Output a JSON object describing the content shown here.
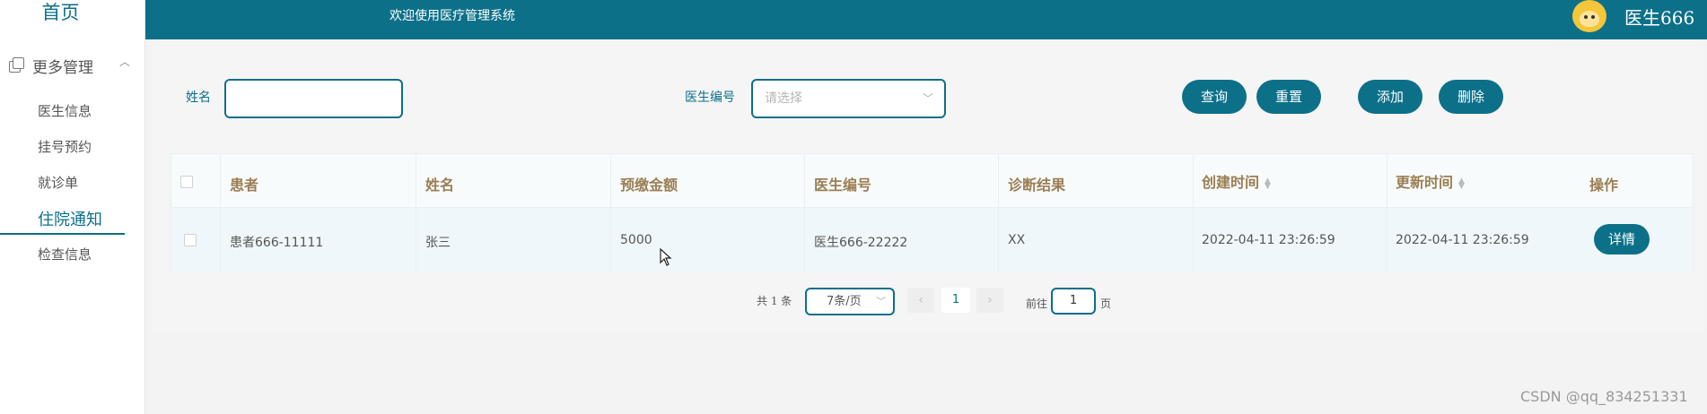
{
  "sidebar": {
    "home": "首页",
    "group_label": "更多管理",
    "items": [
      {
        "label": "医生信息"
      },
      {
        "label": "挂号预约"
      },
      {
        "label": "就诊单"
      },
      {
        "label": "住院通知"
      },
      {
        "label": "检查信息"
      }
    ],
    "active_index": 3
  },
  "header": {
    "welcome": "欢迎使用医疗管理系统",
    "user": "医生666"
  },
  "search": {
    "name_label": "姓名",
    "name_value": "",
    "doctor_no_label": "医生编号",
    "doctor_no_placeholder": "请选择",
    "buttons": {
      "query": "查询",
      "reset": "重置",
      "add": "添加",
      "delete": "删除"
    }
  },
  "table": {
    "columns": [
      "患者",
      "姓名",
      "预缴金额",
      "医生编号",
      "诊断结果",
      "创建时间",
      "更新时间",
      "操作"
    ],
    "rows": [
      {
        "patient": "患者666-11111",
        "name": "张三",
        "prepaid": "5000",
        "doctor_no": "医生666-22222",
        "diagnosis": "XX",
        "created": "2022-04-11 23:26:59",
        "updated": "2022-04-11 23:26:59",
        "action": "详情"
      }
    ]
  },
  "pagination": {
    "total_text": "共 1 条",
    "page_size": "7条/页",
    "current_page": "1",
    "goto_label": "前往",
    "goto_value": "1",
    "goto_suffix": "页"
  },
  "watermark": "CSDN @qq_834251331"
}
